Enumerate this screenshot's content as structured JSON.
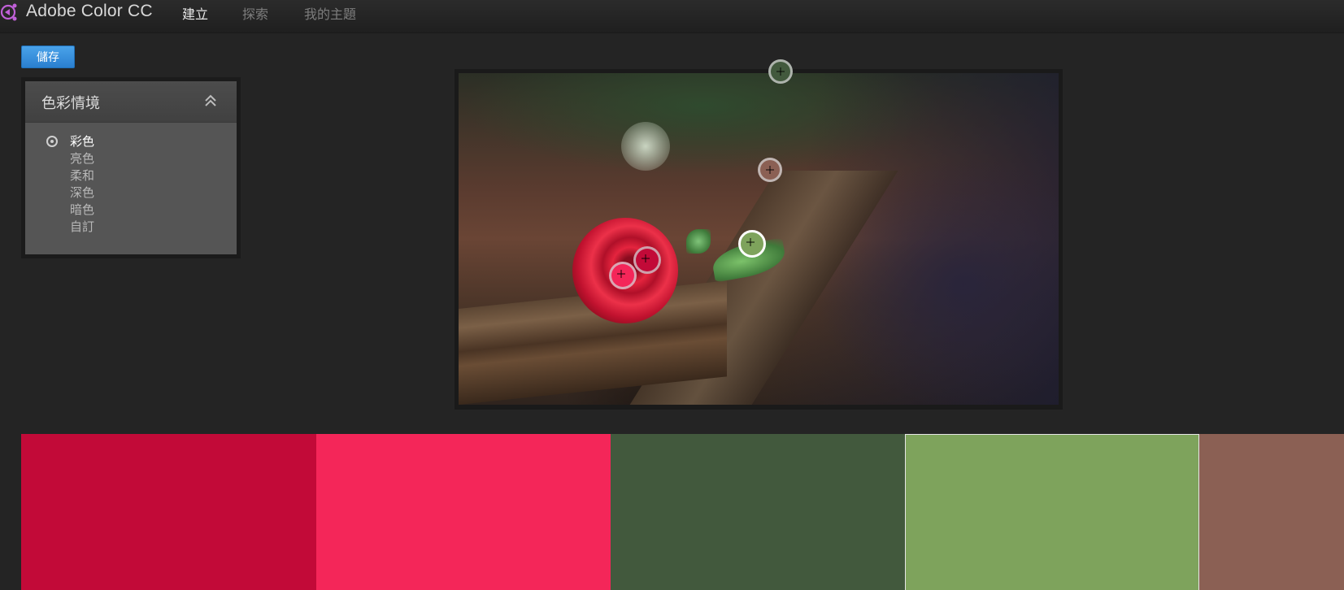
{
  "app": {
    "title": "Adobe Color CC",
    "logo_icon": "adobe-color-logo-icon",
    "logo_color": "#c060d8"
  },
  "nav": {
    "items": [
      {
        "label": "建立",
        "active": true
      },
      {
        "label": "探索",
        "active": false
      },
      {
        "label": "我的主題",
        "active": false
      }
    ]
  },
  "toolbar": {
    "save_label": "儲存",
    "save_color": "#2f86d6"
  },
  "mood_panel": {
    "title": "色彩情境",
    "collapse_icon": "chevron-double-up-icon",
    "options": [
      {
        "label": "彩色",
        "selected": true
      },
      {
        "label": "亮色",
        "selected": false
      },
      {
        "label": "柔和",
        "selected": false
      },
      {
        "label": "深色",
        "selected": false
      },
      {
        "label": "暗色",
        "selected": false
      },
      {
        "label": "自訂",
        "selected": false
      }
    ]
  },
  "image": {
    "subject": "rose-on-wooden-bench-photo",
    "pickers": [
      {
        "color": "#42593d",
        "active": false
      },
      {
        "color": "#8b6054",
        "active": false
      },
      {
        "color": "#7ea35c",
        "active": true
      },
      {
        "color": "#c20a38",
        "active": false
      },
      {
        "color": "#f42659",
        "active": false
      }
    ]
  },
  "swatches": [
    {
      "color": "#c20a38",
      "selected": false
    },
    {
      "color": "#f42659",
      "selected": false
    },
    {
      "color": "#42593d",
      "selected": false
    },
    {
      "color": "#7ea35c",
      "selected": true
    },
    {
      "color": "#8b6054",
      "selected": false
    }
  ]
}
